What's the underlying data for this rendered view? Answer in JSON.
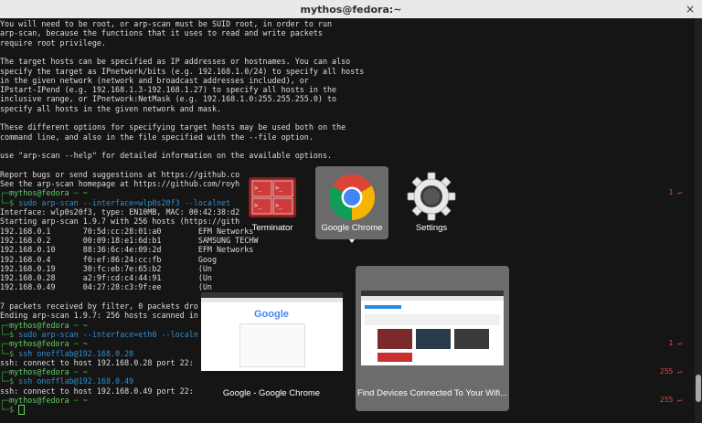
{
  "window": {
    "title": "mythos@fedora:~",
    "close": "×"
  },
  "terminal": {
    "lines": [
      "You will need to be root, or arp-scan must be SUID root, in order to run",
      "arp-scan, because the functions that it uses to read and write packets",
      "require root privilege.",
      "",
      "The target hosts can be specified as IP addresses or hostnames. You can also",
      "specify the target as IPnetwork/bits (e.g. 192.168.1.0/24) to specify all hosts",
      "in the given network (network and broadcast addresses included), or",
      "IPstart-IPend (e.g. 192.168.1.3-192.168.1.27) to specify all hosts in the",
      "inclusive range, or IPnetwork:NetMask (e.g. 192.168.1.0:255.255.255.0) to",
      "specify all hosts in the given network and mask.",
      "",
      "These different options for specifying target hosts may be used both on the",
      "command line, and also in the file specified with the --file option.",
      "",
      "use \"arp-scan --help\" for detailed information on the available options.",
      "",
      "Report bugs or send suggestions at https://github.co",
      "See the arp-scan homepage at https://github.com/royh"
    ],
    "prompt_user": "mythos@fedora",
    "prompt_dir": "~",
    "cmd1": "sudo arp-scan --interface=wlp0s20f3 --localnet",
    "cmd1_status": "1 ↵",
    "scan1": [
      "Interface: wlp0s20f3, type: EN10MB, MAC: 00:42:38:d2",
      "Starting arp-scan 1.9.7 with 256 hosts (https://gith",
      "192.168.0.1       70:5d:cc:28:01:a0        EFM Networks",
      "192.168.0.2       00:09:18:e1:6d:b1        SAMSUNG TECHW",
      "192.168.0.10      88:36:6c:4e:09:2d        EFM Networks",
      "192.168.0.4       f0:ef:86:24:cc:fb        Goog",
      "192.168.0.19      30:fc:eb:7e:65:b2        (Un",
      "192.168.0.28      a2:9f:cd:c4:44:91        (Un",
      "192.168.0.49      04:27:28:c3:9f:ee        (Un",
      "",
      "7 packets received by filter, 0 packets dro",
      "Ending arp-scan 1.9.7: 256 hosts scanned in"
    ],
    "cmd2": "sudo arp-scan --interface=eth0 --localn",
    "cmd3": "ssh onofflab@192.168.0.28",
    "cmd3_status": "1 ↵",
    "out3": "ssh: connect to host 192.168.0.28 port 22:",
    "cmd4": "ssh onofflab@192.168.0.49",
    "cmd4_status": "255 ↵",
    "out4": "ssh: connect to host 192.168.0.49 port 22:",
    "final_status": "255 ↵"
  },
  "switcher": {
    "apps": [
      {
        "label": "Terminator",
        "icon": "terminator-icon"
      },
      {
        "label": "Google Chrome",
        "icon": "chrome-icon"
      },
      {
        "label": "Settings",
        "icon": "settings-gear-icon"
      }
    ],
    "windows": [
      {
        "label": "Google - Google Chrome"
      },
      {
        "label": "Find Devices Connected To Your Wifi..."
      }
    ],
    "google_logo": "Google"
  }
}
